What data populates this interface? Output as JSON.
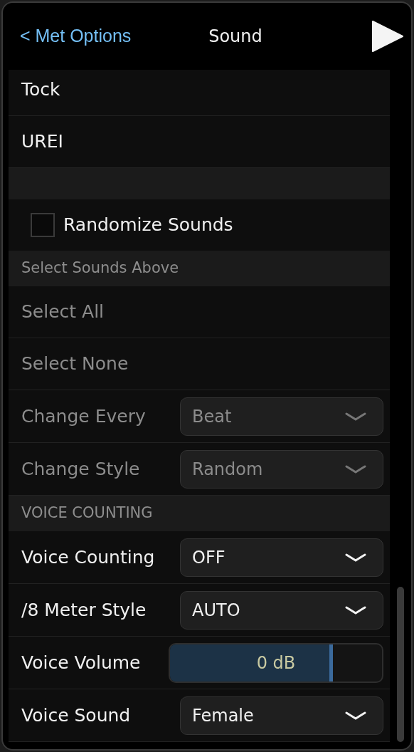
{
  "header": {
    "back": "< Met Options",
    "title": "Sound"
  },
  "rows": [
    {
      "kind": "item",
      "label": "Tock",
      "disabled": false
    },
    {
      "kind": "item",
      "label": "UREI",
      "disabled": false
    },
    {
      "kind": "spacer"
    },
    {
      "kind": "checkbox",
      "label": "Randomize Sounds",
      "checked": false,
      "disabled": false
    },
    {
      "kind": "header",
      "label": "Select Sounds Above"
    },
    {
      "kind": "item",
      "label": "Select All",
      "disabled": true
    },
    {
      "kind": "item",
      "label": "Select None",
      "disabled": true
    },
    {
      "kind": "select",
      "label": "Change Every",
      "value": "Beat",
      "disabled": true
    },
    {
      "kind": "select",
      "label": "Change Style",
      "value": "Random",
      "disabled": true
    },
    {
      "kind": "header",
      "label": "VOICE COUNTING"
    },
    {
      "kind": "select",
      "label": "Voice Counting",
      "value": "OFF",
      "disabled": false
    },
    {
      "kind": "select",
      "label": "/8 Meter Style",
      "value": "AUTO",
      "disabled": false
    },
    {
      "kind": "slider",
      "label": "Voice Volume",
      "reading": "0 dB",
      "level": 0.77,
      "disabled": false
    },
    {
      "kind": "select",
      "label": "Voice Sound",
      "value": "Female",
      "disabled": false
    }
  ]
}
